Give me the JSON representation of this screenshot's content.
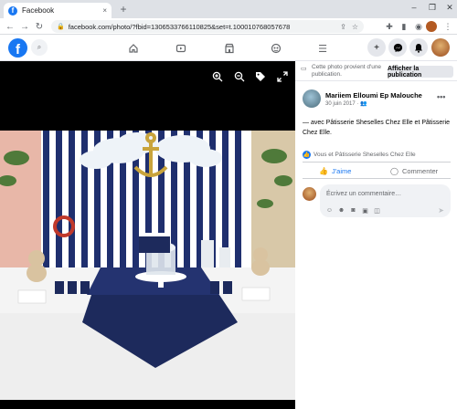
{
  "browser": {
    "tab_title": "Facebook",
    "tab_close": "×",
    "new_tab": "+",
    "window_minimize": "–",
    "window_restore": "❐",
    "window_close": "✕",
    "url": "facebook.com/photo/?fbid=1306533766110825&set=t.100010768057678"
  },
  "facebook": {
    "logo": "f",
    "nav_icons": [
      "home-icon",
      "watch-icon",
      "marketplace-icon",
      "groups-icon",
      "menu-icon"
    ],
    "brand_color": "#1877f2"
  },
  "viewer": {
    "tools": [
      "zoom-in-icon",
      "zoom-out-icon",
      "tag-icon",
      "fullscreen-icon"
    ]
  },
  "sidebar": {
    "notice": "Cette photo provient d'une publication.",
    "show_post": "Afficher la publication",
    "author": "Mariiem Elloumi Ep Malouche",
    "date": "30 juin 2017 ·",
    "post_text": "— avec Pâtisserie Sheselles Chez Elle et Pâtisserie Chez Elle.",
    "reactions": "Vous et Pâtisserie Sheselles Chez Elle",
    "like": "J'aime",
    "comment": "Commenter",
    "comment_placeholder": "Écrivez un commentaire…"
  }
}
